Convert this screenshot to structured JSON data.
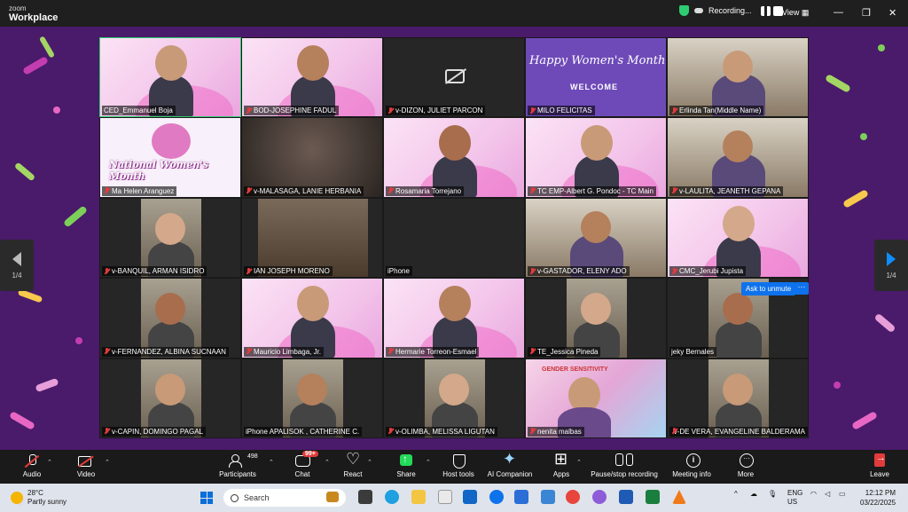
{
  "app": {
    "logo_line1": "zoom",
    "logo_line2": "Workplace",
    "recording_label": "Recording...",
    "view_label": "View"
  },
  "colors": {
    "stage_bg": "#4a1a6b",
    "active_speaker": "#2ecc71",
    "accent_blue": "#0e72ed",
    "leave_red": "#e23b3b"
  },
  "page_indicator": {
    "left": "1/4",
    "right": "1/4"
  },
  "tiles": [
    {
      "name": "CED_Emmanuel Boja",
      "muted": false,
      "bg": "pink"
    },
    {
      "name": "BOD-JOSEPHINE FADUL",
      "muted": true,
      "bg": "pink"
    },
    {
      "name": "v-DIZON, JULIET PARCON",
      "muted": true,
      "bg": "camoff"
    },
    {
      "name": "MILO FELICITAS",
      "muted": true,
      "bg": "hw"
    },
    {
      "name": "Erlinda Tan(Middle Name)",
      "muted": true,
      "bg": "room"
    },
    {
      "name": "Ma Helen Aranguez",
      "muted": true,
      "bg": "nwm"
    },
    {
      "name": "v-MALASAGA, LANIE HERBANIA",
      "muted": true,
      "bg": "blur"
    },
    {
      "name": "Rosamaria Torrejano",
      "muted": true,
      "bg": "pink"
    },
    {
      "name": "TC EMP-Albert G. Pondoc - TC Main",
      "muted": true,
      "bg": "pink"
    },
    {
      "name": "v-LAULITA, JEANETH GEPANA",
      "muted": true,
      "bg": "room"
    },
    {
      "name": "v-BANQUIL, ARMAN ISIDRO",
      "muted": true,
      "bg": "narrow"
    },
    {
      "name": "IAN JOSEPH MORENO",
      "muted": true,
      "bg": "ceiling"
    },
    {
      "name": "iPhone",
      "muted": false,
      "bg": "black"
    },
    {
      "name": "v-GASTADOR, ELENY ADO",
      "muted": true,
      "bg": "room"
    },
    {
      "name": "CMC_Jerubi Jupista",
      "muted": true,
      "bg": "pink"
    },
    {
      "name": "v-FERNANDEZ, ALBINA SUCNAAN",
      "muted": true,
      "bg": "narrow"
    },
    {
      "name": "Mauricio Limbaga, Jr.",
      "muted": true,
      "bg": "pink"
    },
    {
      "name": "Hermarie Torreon-Esmael",
      "muted": true,
      "bg": "pink"
    },
    {
      "name": "TE_Jessica Pineda",
      "muted": true,
      "bg": "narrow"
    },
    {
      "name": "jeky Bernales",
      "muted": false,
      "bg": "narrow"
    },
    {
      "name": "v-CAPIN, DOMINGO PAGAL",
      "muted": true,
      "bg": "narrow"
    },
    {
      "name": "iPhone APALISOK , CATHERINE C.",
      "muted": false,
      "bg": "narrow"
    },
    {
      "name": "v-OLIMBA, MELISSA LIGUTAN",
      "muted": true,
      "bg": "narrow"
    },
    {
      "name": "nenita malbas",
      "muted": true,
      "bg": "gs"
    },
    {
      "name": "v-DE VERA, EVANGELINE BALDERAMA",
      "muted": true,
      "bg": "narrow"
    }
  ],
  "banners": {
    "happy_womens_month": "Happy Women's Month",
    "welcome": "WELCOME",
    "national_womens_month": "National Women's Month",
    "gender_sensitive": "GENDER SENSITIVITY"
  },
  "ask_to_unmute": "Ask to unmute",
  "more_options": "···",
  "toolbar": {
    "audio": "Audio",
    "video": "Video",
    "participants": "Participants",
    "participant_count": "498",
    "chat": "Chat",
    "chat_badge": "99+",
    "react": "React",
    "share": "Share",
    "host_tools": "Host tools",
    "ai_companion": "AI Companion",
    "apps": "Apps",
    "pause_stop": "Pause/stop recording",
    "meeting_info": "Meeting info",
    "more": "More",
    "leave": "Leave"
  },
  "taskbar": {
    "temp": "28°C",
    "weather": "Partly sunny",
    "search_placeholder": "Search",
    "lang1": "ENG",
    "lang2": "US",
    "time": "12:12 PM",
    "date": "03/22/2025"
  }
}
